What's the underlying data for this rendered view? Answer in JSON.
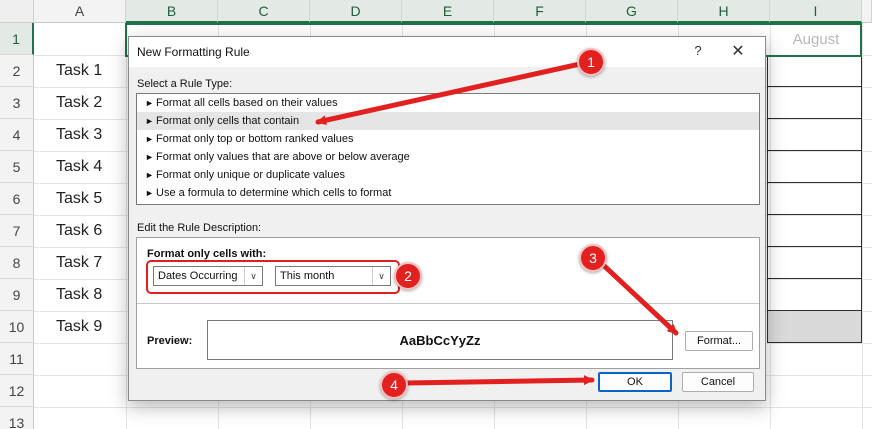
{
  "sheet": {
    "columns": [
      "A",
      "B",
      "C",
      "D",
      "E",
      "F",
      "G",
      "H",
      "I"
    ],
    "rows": [
      "1",
      "2",
      "3",
      "4",
      "5",
      "6",
      "7",
      "8",
      "9",
      "10",
      "11",
      "12",
      "13"
    ],
    "tasks": [
      "Task 1",
      "Task 2",
      "Task 3",
      "Task 4",
      "Task 5",
      "Task 6",
      "Task 7",
      "Task 8",
      "Task 9"
    ],
    "month_header": "August"
  },
  "dialog": {
    "title": "New Formatting Rule",
    "help": "?",
    "close": "✕",
    "select_type_label": "Select a Rule Type:",
    "rule_types": [
      "Format all cells based on their values",
      "Format only cells that contain",
      "Format only top or bottom ranked values",
      "Format only values that are above or below average",
      "Format only unique or duplicate values",
      "Use a formula to determine which cells to format"
    ],
    "selected_rule_index": 1,
    "edit_desc_label": "Edit the Rule Description:",
    "format_only_label": "Format only cells with:",
    "condition_value": "Dates Occurring",
    "period_value": "This month",
    "preview_label": "Preview:",
    "preview_text": "AaBbCcYyZz",
    "format_button": "Format...",
    "ok_button": "OK",
    "cancel_button": "Cancel"
  },
  "annotations": {
    "step1": "1",
    "step2": "2",
    "step3": "3",
    "step4": "4",
    "accent": "#e32020"
  },
  "colors": {
    "excel_green": "#217346",
    "dialog_bg": "#f0f0f0",
    "default_button_border": "#0a64c8"
  }
}
